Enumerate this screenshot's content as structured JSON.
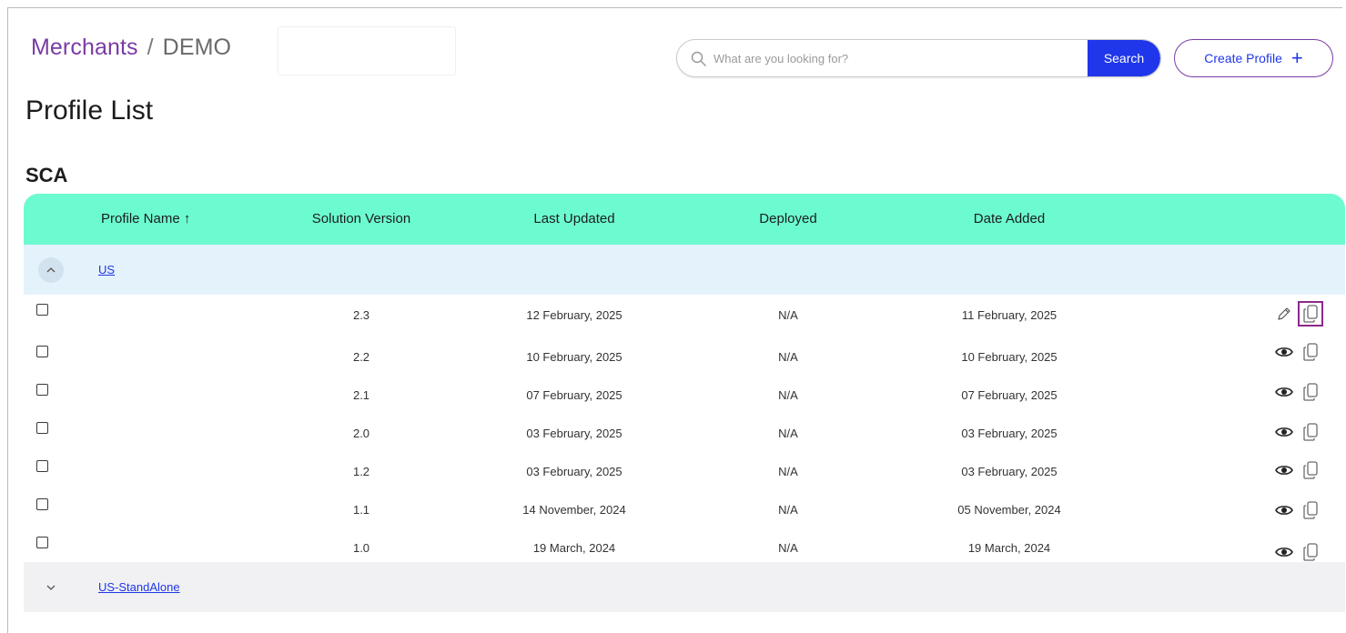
{
  "breadcrumb": {
    "root": "Merchants",
    "separator": "/",
    "current": "DEMO"
  },
  "search": {
    "placeholder": "What are you looking for?",
    "button_label": "Search"
  },
  "create_button": {
    "label": "Create Profile",
    "icon": "+"
  },
  "page_title": "Profile List",
  "section_title": "SCA",
  "table": {
    "headers": {
      "profile_name": "Profile Name",
      "sort_indicator": "↑",
      "solution_version": "Solution Version",
      "last_updated": "Last Updated",
      "deployed": "Deployed",
      "date_added": "Date Added"
    },
    "groups": [
      {
        "name": "US",
        "expanded": true,
        "rows": [
          {
            "version": "2.3",
            "last_updated": "12 February, 2025",
            "deployed": "N/A",
            "date_added": "11 February, 2025",
            "primary_action": "edit-icon"
          },
          {
            "version": "2.2",
            "last_updated": "10 February, 2025",
            "deployed": "N/A",
            "date_added": "10 February, 2025",
            "primary_action": "view-icon"
          },
          {
            "version": "2.1",
            "last_updated": "07 February, 2025",
            "deployed": "N/A",
            "date_added": "07 February, 2025",
            "primary_action": "view-icon"
          },
          {
            "version": "2.0",
            "last_updated": "03 February, 2025",
            "deployed": "N/A",
            "date_added": "03 February, 2025",
            "primary_action": "view-icon"
          },
          {
            "version": "1.2",
            "last_updated": "03 February, 2025",
            "deployed": "N/A",
            "date_added": "03 February, 2025",
            "primary_action": "view-icon"
          },
          {
            "version": "1.1",
            "last_updated": "14 November, 2024",
            "deployed": "N/A",
            "date_added": "05 November, 2024",
            "primary_action": "view-icon"
          },
          {
            "version": "1.0",
            "last_updated": "19 March, 2024",
            "deployed": "N/A",
            "date_added": "19 March, 2024",
            "primary_action": "view-icon"
          }
        ]
      },
      {
        "name": "US-StandAlone",
        "expanded": false,
        "rows": []
      }
    ]
  },
  "colors": {
    "header_bg": "#6cfbd0",
    "expanded_group_bg": "#e4f2fc",
    "collapsed_group_bg": "#f1f1f3",
    "primary_blue": "#1f36ea",
    "breadcrumb_purple": "#7a3ba4",
    "highlight_outline": "#8b2a8b"
  }
}
